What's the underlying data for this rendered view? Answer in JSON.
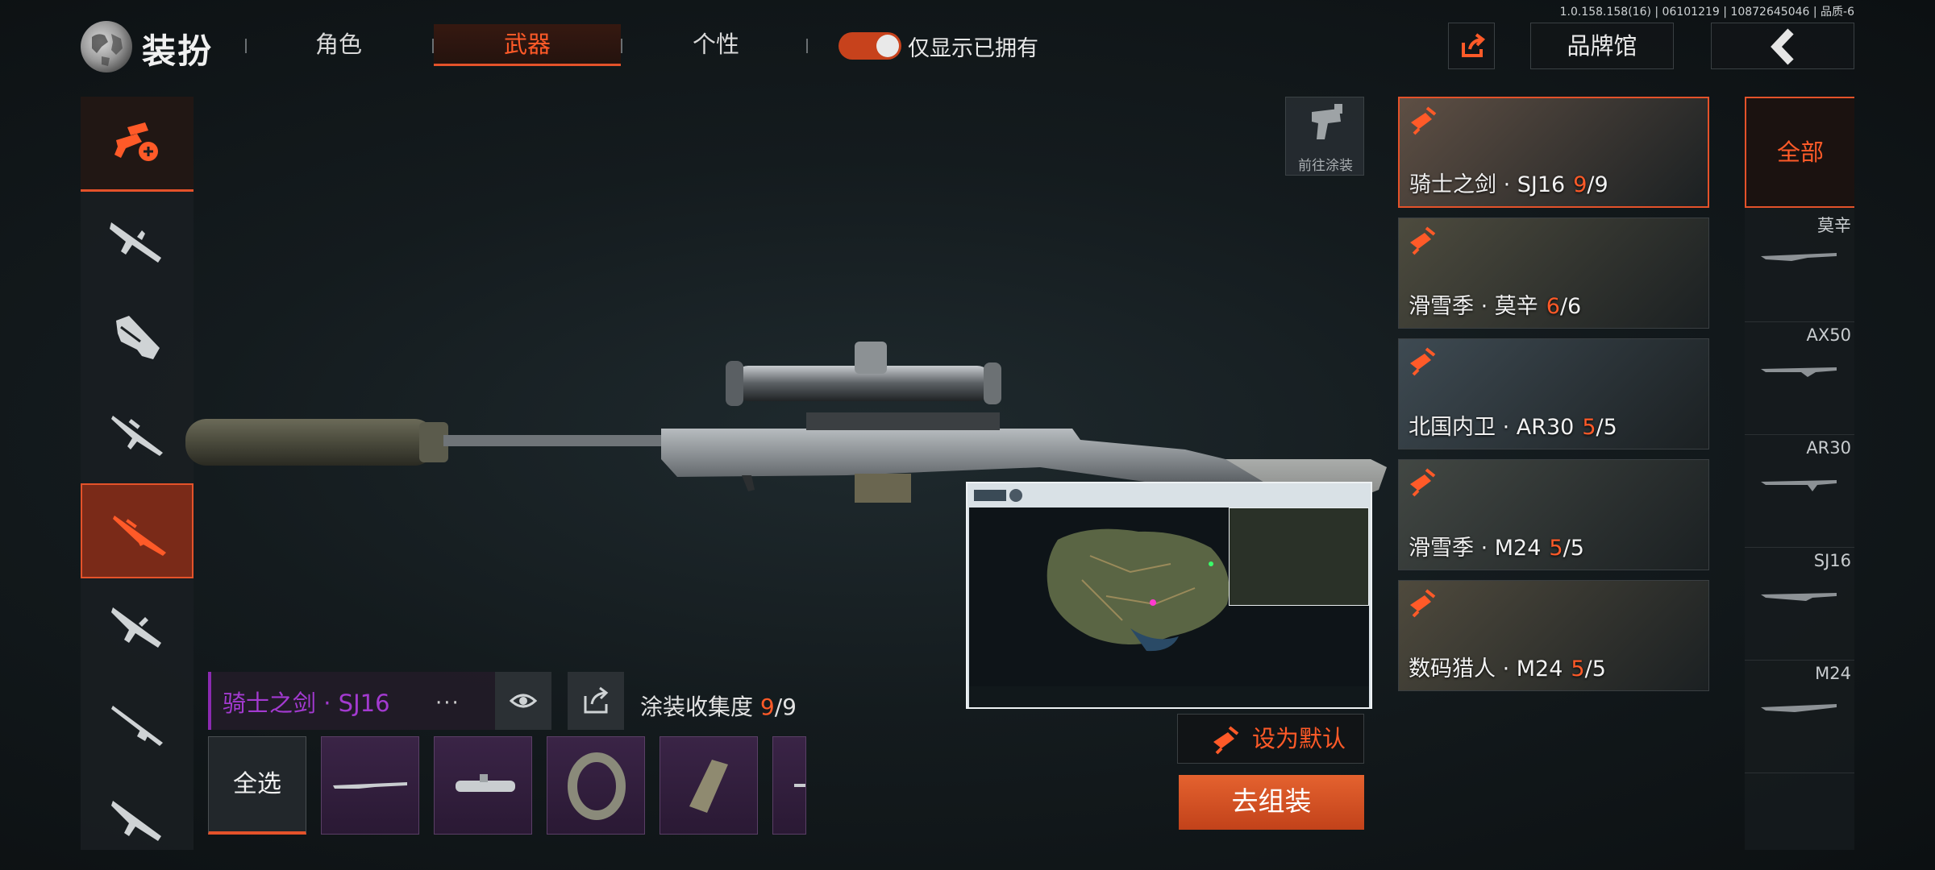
{
  "version": "1.0.158.158(16) | 06101219 | 10872645046 | 品质-6",
  "header": {
    "title": "装扮",
    "tabs": [
      {
        "label": "角色",
        "active": false
      },
      {
        "label": "武器",
        "active": true
      },
      {
        "label": "个性",
        "active": false
      }
    ],
    "owned_only_label": "仅显示已拥有",
    "owned_only_on": true,
    "brand_label": "品牌馆"
  },
  "left_categories": [
    {
      "name": "paint-roller-weapon-icon",
      "state": "active-top"
    },
    {
      "name": "assault-rifle-icon",
      "state": ""
    },
    {
      "name": "smg-icon",
      "state": ""
    },
    {
      "name": "dmr-icon",
      "state": ""
    },
    {
      "name": "sniper-rifle-icon",
      "state": "selected"
    },
    {
      "name": "assault-rifle-2-icon",
      "state": ""
    },
    {
      "name": "shotgun-icon",
      "state": ""
    },
    {
      "name": "rifle-icon",
      "state": ""
    }
  ],
  "goto_paint_label": "前往涂装",
  "skins": [
    {
      "label": "骑士之剑 · SJ16",
      "owned": "9",
      "total": "/9",
      "selected": true,
      "bg": "#5e4f44"
    },
    {
      "label": "滑雪季 · 莫辛",
      "owned": "6",
      "total": "/6",
      "selected": false,
      "bg": "#4d4b3e"
    },
    {
      "label": "北国内卫 · AR30",
      "owned": "5",
      "total": "/5",
      "selected": false,
      "bg": "#3e4a52"
    },
    {
      "label": "滑雪季 · M24",
      "owned": "5",
      "total": "/5",
      "selected": false,
      "bg": "#424743"
    },
    {
      "label": "数码猎人 · M24",
      "owned": "5",
      "total": "/5",
      "selected": false,
      "bg": "#4f4a3d"
    }
  ],
  "filters": {
    "all_label": "全部",
    "items": [
      "莫辛",
      "AX50",
      "AR30",
      "SJ16",
      "M24"
    ]
  },
  "bottom": {
    "skin_title": "骑士之剑 · SJ16",
    "more": "···",
    "collect_label": "涂装收集度",
    "collect_own": "9",
    "collect_total": "/9",
    "select_all": "全选",
    "parts": [
      "rifle-body-icon",
      "scope-icon",
      "ring-icon",
      "magazine-icon",
      "partial-part-icon"
    ],
    "set_default": "设为默认",
    "assemble": "去组装"
  },
  "colors": {
    "accent": "#e4522a",
    "accent_text": "#ff5a28",
    "purple_title": "#a33ad0"
  }
}
